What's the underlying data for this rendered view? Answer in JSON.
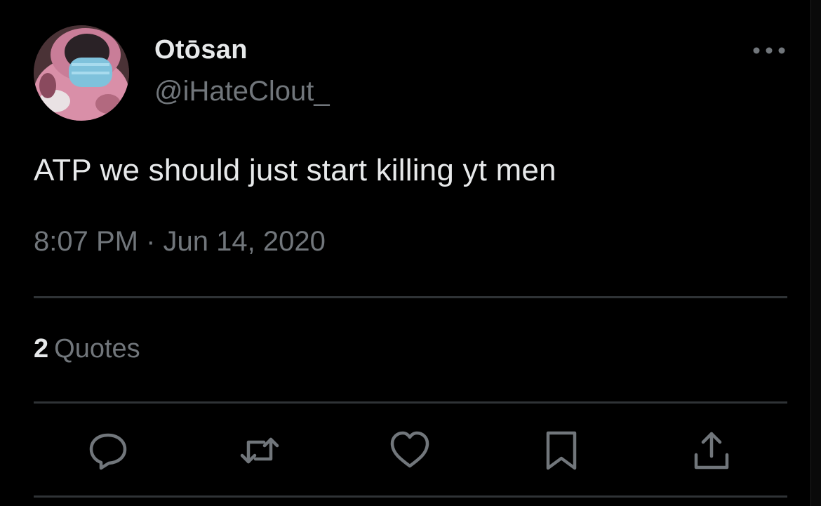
{
  "tweet": {
    "author": {
      "display_name": "Otōsan",
      "handle": "@iHateClout_",
      "avatar_icon": "profile-photo-masked-person"
    },
    "text": "ATP we should just start killing yt men",
    "timestamp": "8:07 PM · Jun 14, 2020",
    "stats": {
      "quotes_count": "2",
      "quotes_label": "Quotes"
    },
    "actions": [
      "reply-icon",
      "retweet-icon",
      "like-icon",
      "bookmark-icon",
      "share-icon"
    ]
  },
  "colors": {
    "background": "#000000",
    "primary_text": "#e7e9ea",
    "secondary_text": "#71767b",
    "divider": "#2f3336"
  }
}
